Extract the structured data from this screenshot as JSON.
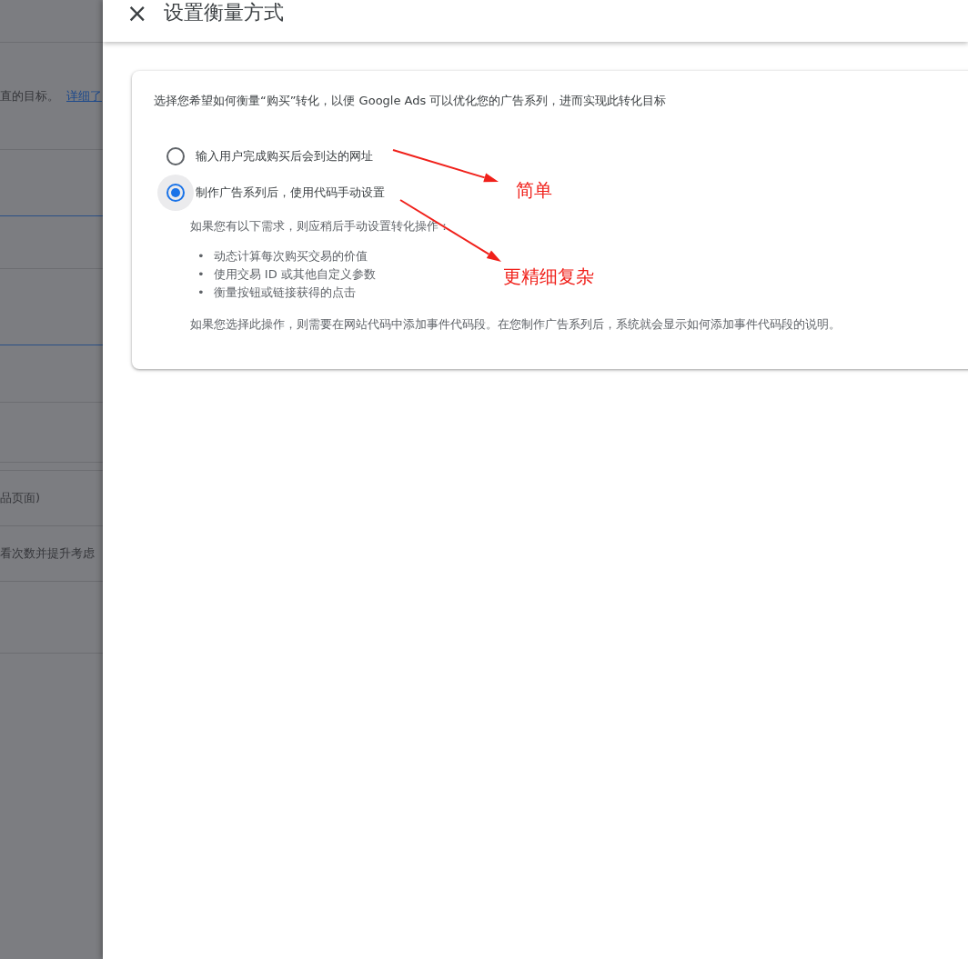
{
  "backdrop": {
    "intro_text": "直的目标。",
    "intro_link": "详细了",
    "line_1": "品页面)",
    "line_2": "看次数并提升考虑"
  },
  "panel": {
    "close": "×",
    "title": "设置衡量方式"
  },
  "card": {
    "prompt": "选择您希望如何衡量“购买”转化，以便 Google Ads 可以优化您的广告系列，进而实现此转化目标",
    "options": [
      {
        "label": "输入用户完成购买后会到达的网址",
        "selected": false
      },
      {
        "label": "制作广告系列后，使用代码手动设置",
        "selected": true
      }
    ],
    "details": {
      "lead": "如果您有以下需求，则应稍后手动设置转化操作：",
      "bullets": [
        {
          "marker": "•",
          "text": "动态计算每次购买交易的价值"
        },
        {
          "marker": "•",
          "text": "使用交易 ID 或其他自定义参数"
        },
        {
          "marker": "•",
          "text": "衡量按钮或链接获得的点击"
        }
      ],
      "note": "如果您选择此操作，则需要在网站代码中添加事件代码段。在您制作广告系列后，系统就会显示如何添加事件代码段的说明。"
    }
  },
  "annotations": [
    "简单",
    "更精细复杂"
  ]
}
